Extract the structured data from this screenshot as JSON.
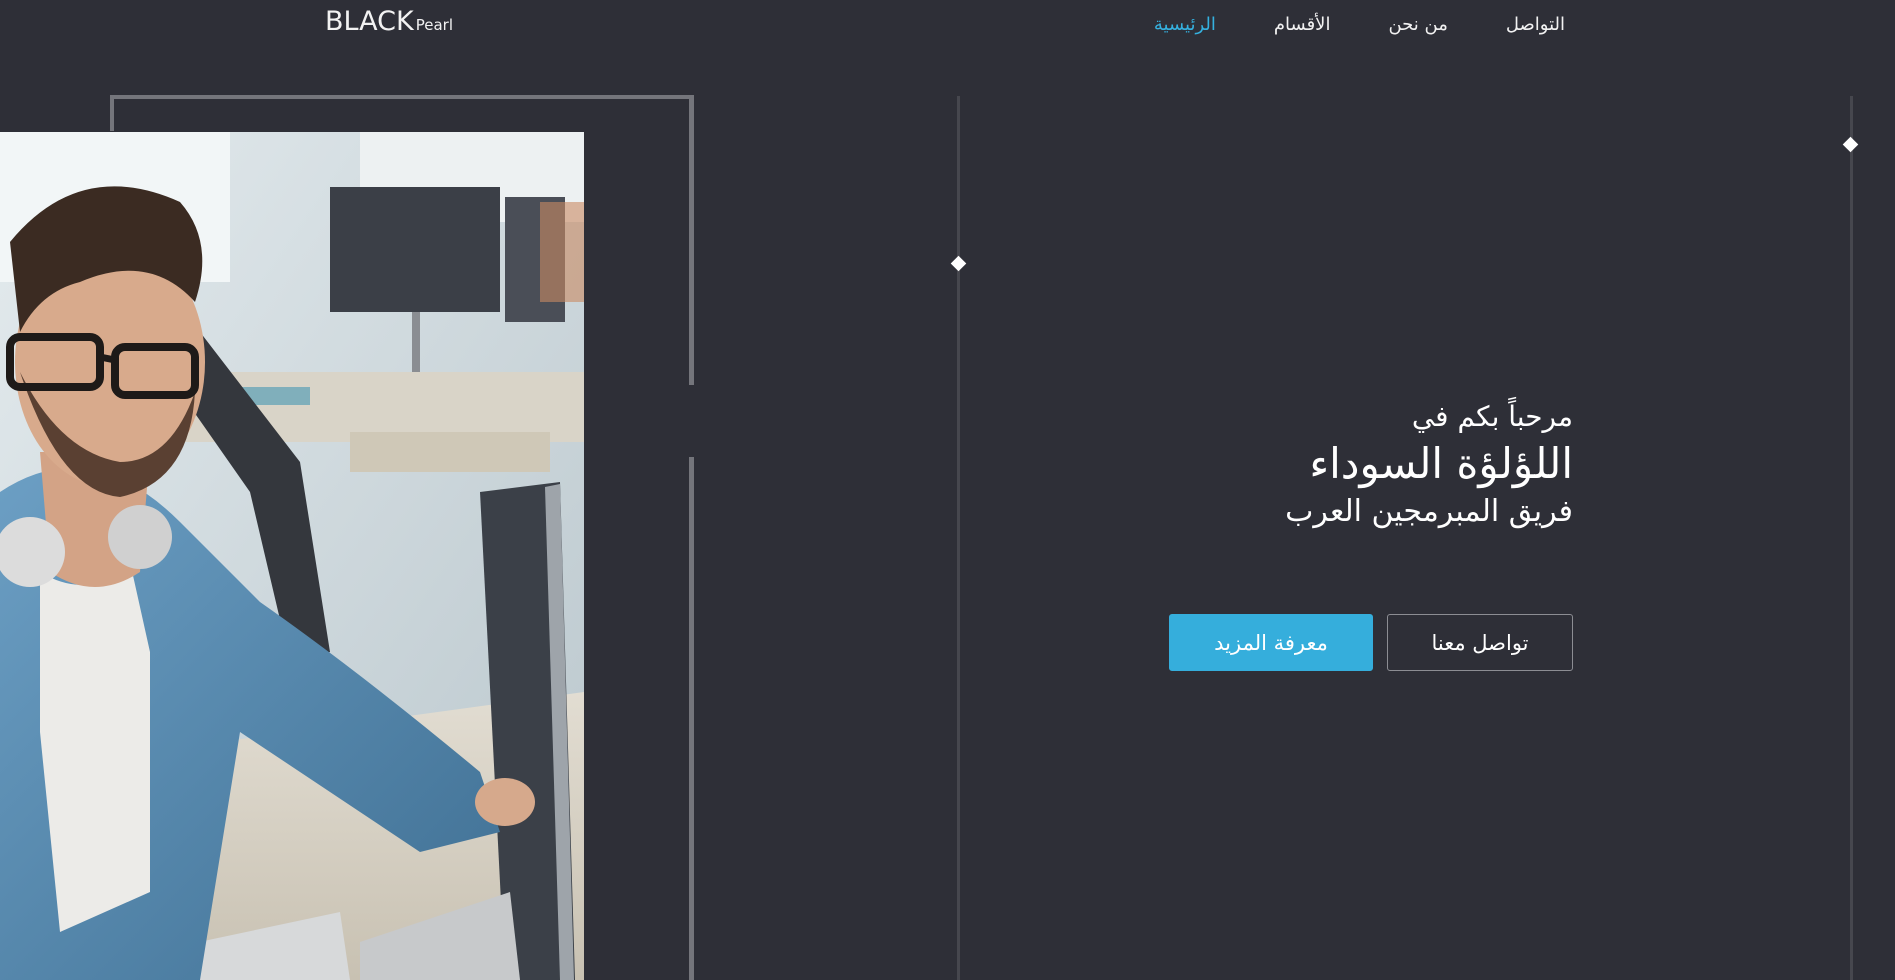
{
  "header": {
    "logo_main": "BLACK",
    "logo_sub": "Pearl",
    "nav": [
      {
        "label": "الرئيسية",
        "active": true
      },
      {
        "label": "الأقسام",
        "active": false
      },
      {
        "label": "من نحن",
        "active": false
      },
      {
        "label": "التواصل",
        "active": false
      }
    ]
  },
  "hero": {
    "welcome": "مرحباً بكم في",
    "title": "اللؤلؤة السوداء",
    "subtitle": "فريق المبرمجين العرب",
    "primary_button": "معرفة المزيد",
    "secondary_button": "تواصل معنا"
  },
  "colors": {
    "background": "#2e2f37",
    "accent": "#35aedc",
    "text": "#ffffff",
    "frame": "#74757b"
  },
  "icons": {
    "marker": "diamond-icon"
  }
}
